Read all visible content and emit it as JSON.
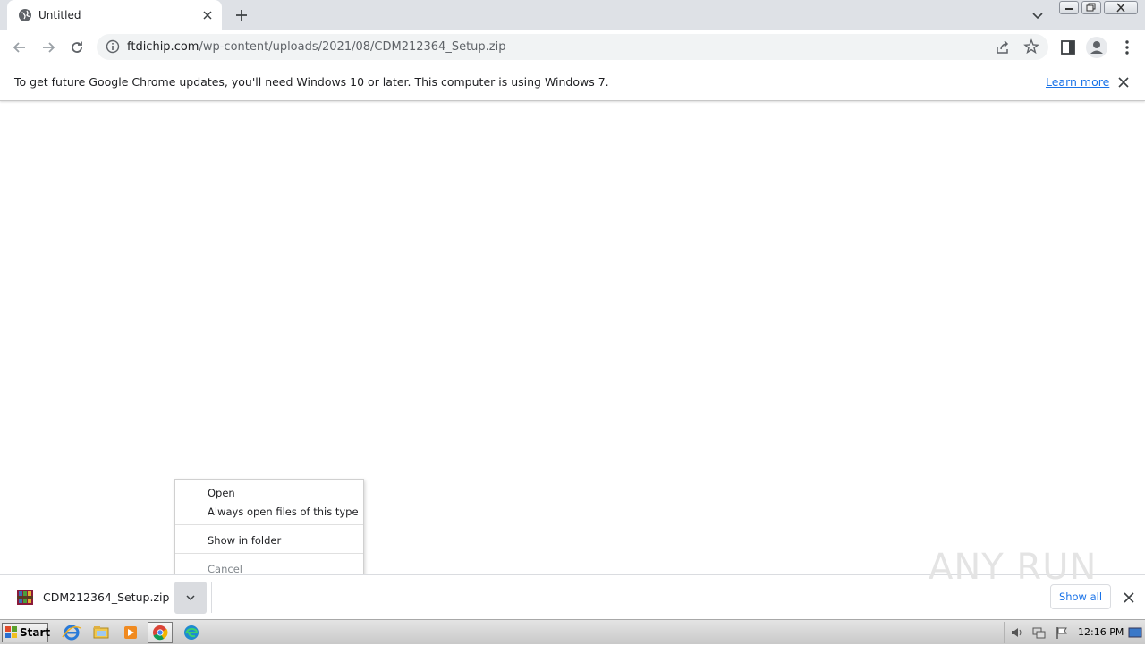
{
  "tab": {
    "title": "Untitled",
    "favicon": "globe-icon"
  },
  "omnibox": {
    "host": "ftdichip.com",
    "path": "/wp-content/uploads/2021/08/CDM212364_Setup.zip"
  },
  "infobar": {
    "message": "To get future Google Chrome updates, you'll need Windows 10 or later. This computer is using Windows 7.",
    "link": "Learn more"
  },
  "context_menu": {
    "items": [
      "Open",
      "Always open files of this type",
      "Show in folder",
      "Cancel"
    ],
    "disabled": [
      "Cancel"
    ]
  },
  "download_shelf": {
    "filename": "CDM212364_Setup.zip",
    "show_all": "Show all",
    "watermark": "ANY RUN"
  },
  "taskbar": {
    "start_label": "Start",
    "apps": [
      "ie-icon",
      "explorer-icon",
      "media-player-icon",
      "chrome-icon",
      "edge-icon"
    ],
    "clock": "12:16 PM"
  },
  "colors": {
    "link": "#1a73e8",
    "tabstrip": "#dee1e6",
    "omnibox": "#f1f3f4"
  }
}
